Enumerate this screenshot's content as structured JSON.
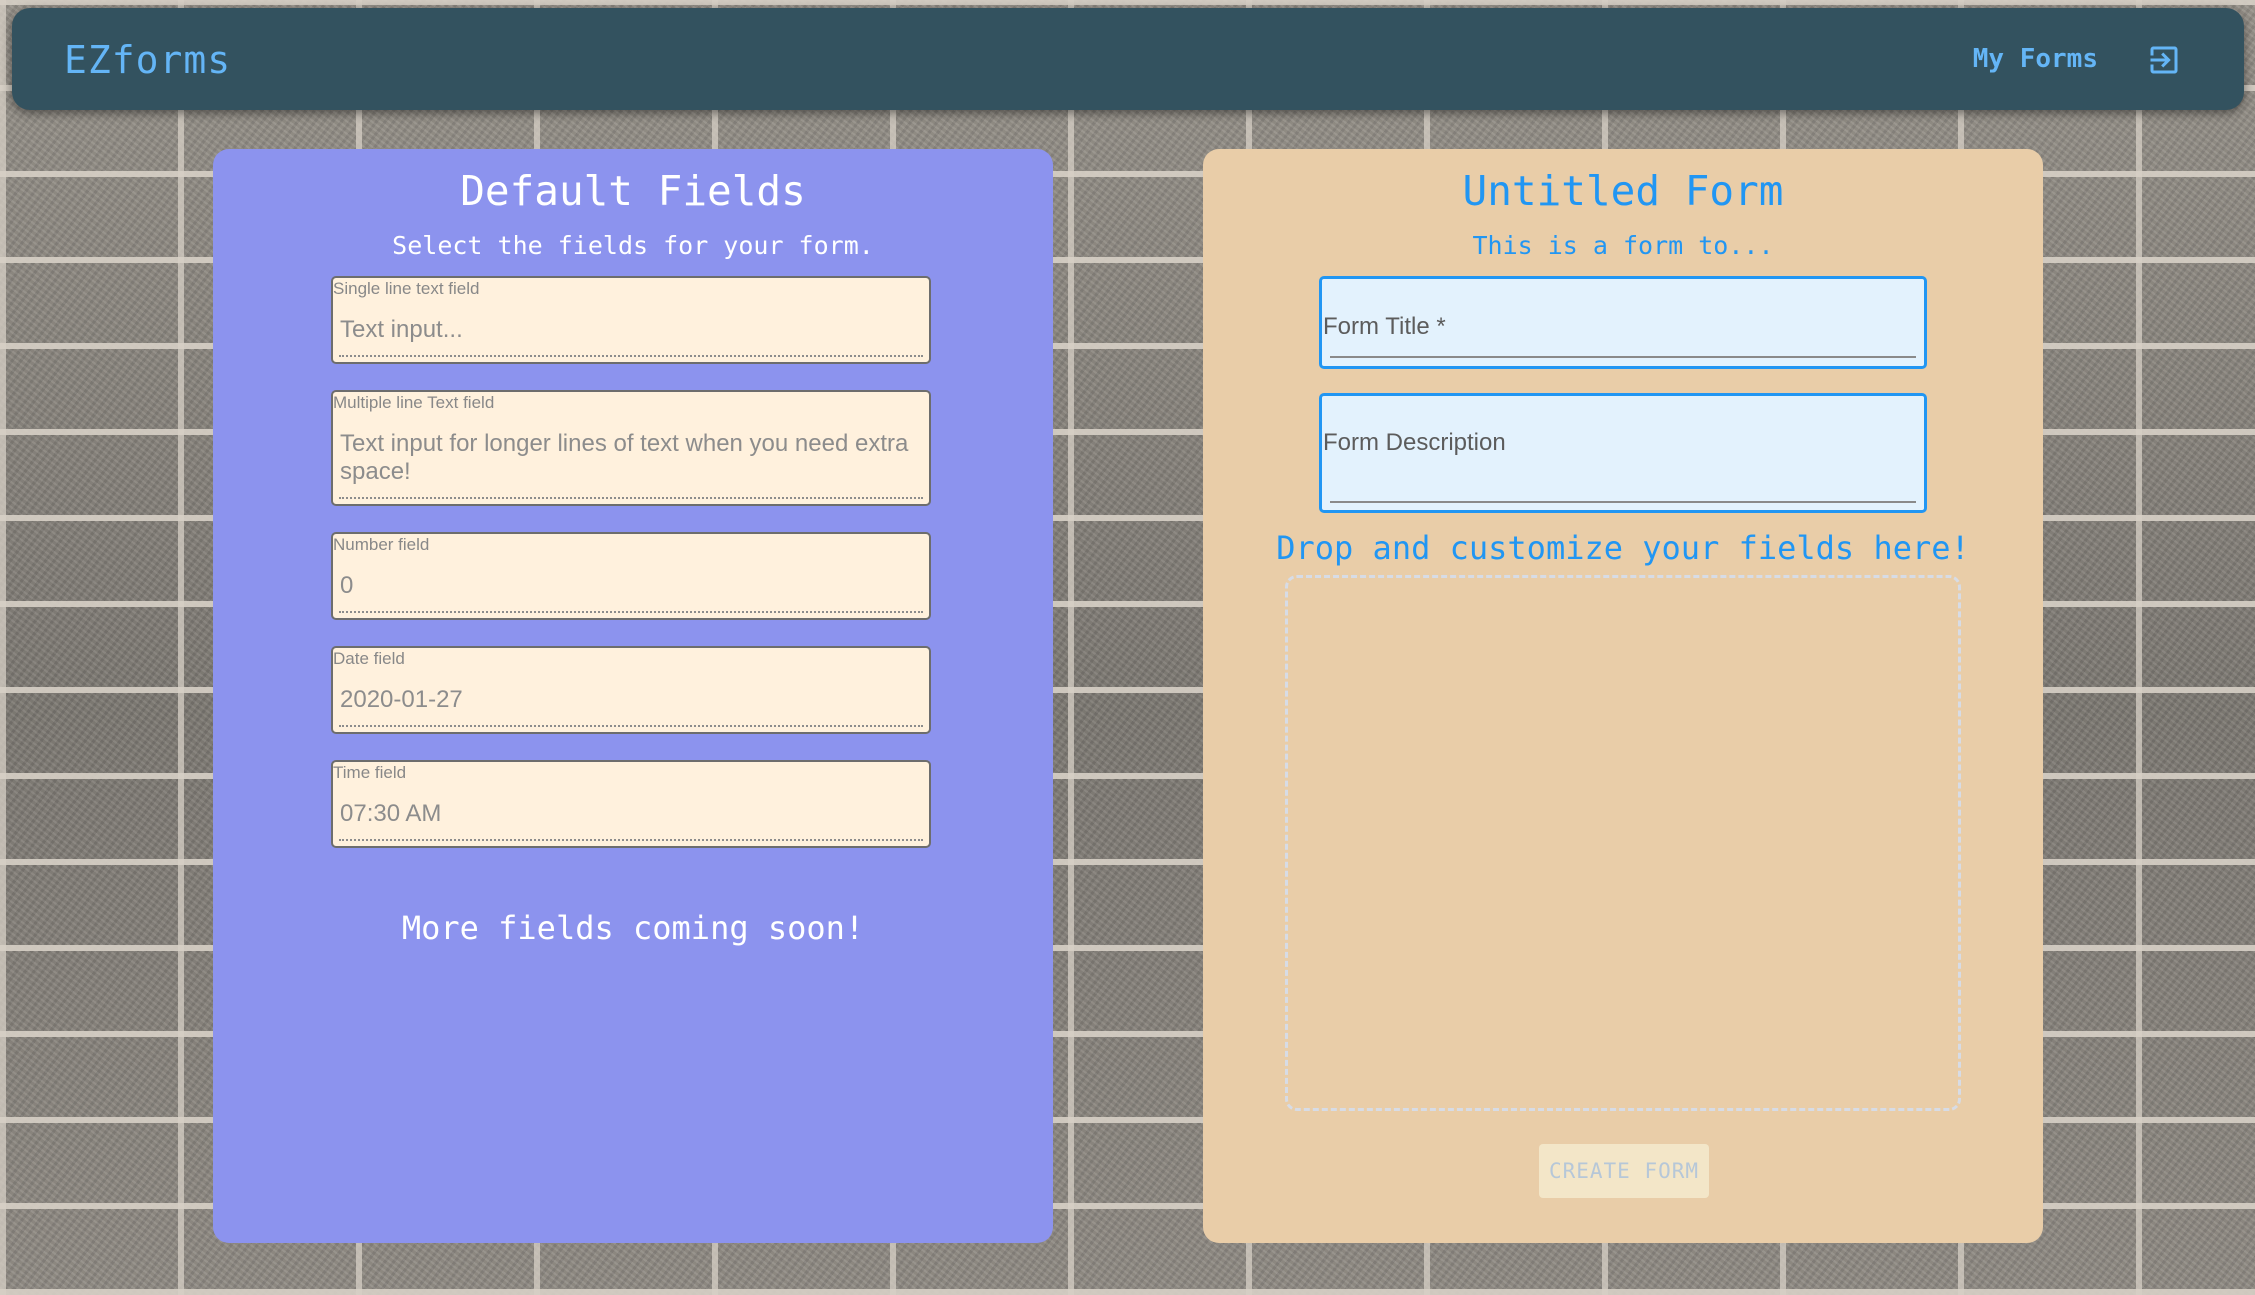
{
  "appbar": {
    "brand": "EZforms",
    "nav_link": "My Forms",
    "logout_icon": "logout-icon"
  },
  "default_fields": {
    "title": "Default Fields",
    "subtitle": "Select the fields for your form.",
    "fields": [
      {
        "label": "Single line text field",
        "value": "Text input..."
      },
      {
        "label": "Multiple line Text field",
        "value": "Text input for longer lines of text when you need extra space!"
      },
      {
        "label": "Number field",
        "value": "0"
      },
      {
        "label": "Date field",
        "value": "2020-01-27"
      },
      {
        "label": "Time field",
        "value": "07:30 AM"
      }
    ],
    "footer": "More fields coming soon!"
  },
  "form": {
    "title": "Untitled Form",
    "subtitle": "This is a form to...",
    "title_input_label": "Form Title *",
    "description_input_label": "Form Description",
    "drop_title": "Drop and customize your fields here!",
    "create_button": "CREATE FORM"
  },
  "colors": {
    "appbar": "#33525f",
    "accent": "#2196f3",
    "left_panel": "#8c93ee",
    "right_panel": "#e9cda8",
    "field_bg": "#fff1dd",
    "input_bg": "#e3f2fd"
  }
}
